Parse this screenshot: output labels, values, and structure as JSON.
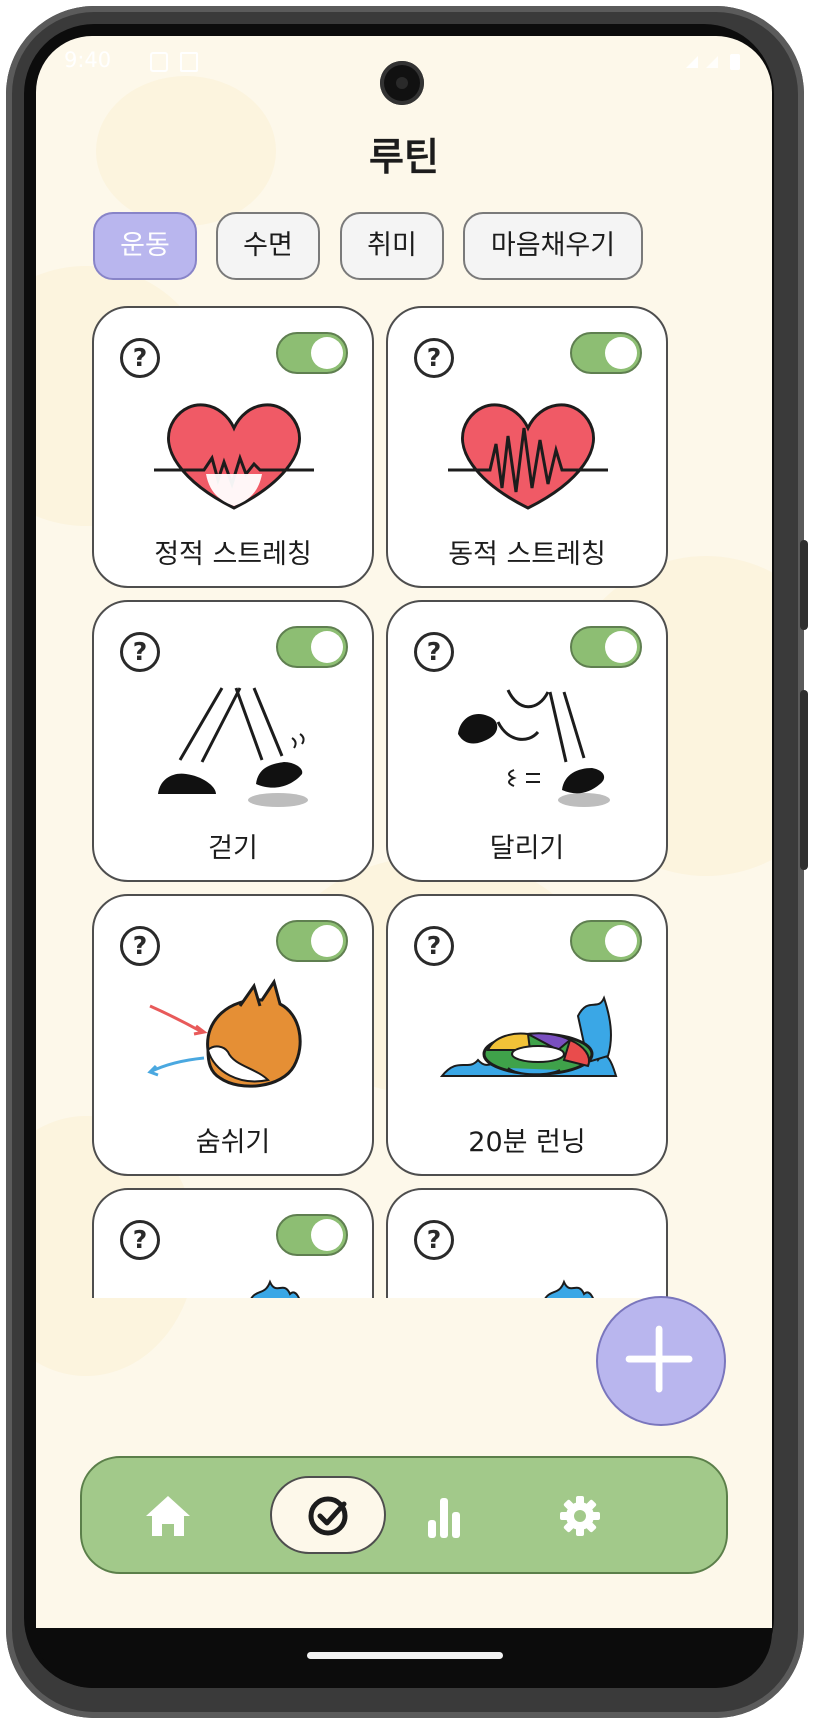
{
  "status_bar": {
    "time": "9:40"
  },
  "header": {
    "title": "루틴"
  },
  "tabs": [
    {
      "label": "운동",
      "active": true
    },
    {
      "label": "수면",
      "active": false
    },
    {
      "label": "취미",
      "active": false
    },
    {
      "label": "마음채우기",
      "active": false
    }
  ],
  "cards": [
    {
      "label": "정적 스트레칭",
      "icon": "heart-pulse",
      "enabled": true
    },
    {
      "label": "동적 스트레칭",
      "icon": "heart-pulse",
      "enabled": true
    },
    {
      "label": "걷기",
      "icon": "walking-legs",
      "enabled": true
    },
    {
      "label": "달리기",
      "icon": "running-legs",
      "enabled": true
    },
    {
      "label": "숨쉬기",
      "icon": "cat-breathing",
      "enabled": true
    },
    {
      "label": "20분 런닝",
      "icon": "swim-ring-splash",
      "enabled": true
    },
    {
      "label": "",
      "icon": "splash",
      "enabled": true
    },
    {
      "label": "",
      "icon": "splash",
      "enabled": true
    }
  ],
  "help_symbol": "?",
  "fab": {
    "icon": "plus-icon"
  },
  "bottom_nav": [
    {
      "icon": "home-icon",
      "active": false
    },
    {
      "icon": "check-circle-icon",
      "active": true
    },
    {
      "icon": "bar-chart-icon",
      "active": false
    },
    {
      "icon": "gear-icon",
      "active": false
    }
  ],
  "colors": {
    "background": "#fdf8ea",
    "accent_purple": "#b9b6ee",
    "accent_green": "#a2c98a",
    "toggle_on": "#8dbe73",
    "heart_red": "#f05a66"
  }
}
